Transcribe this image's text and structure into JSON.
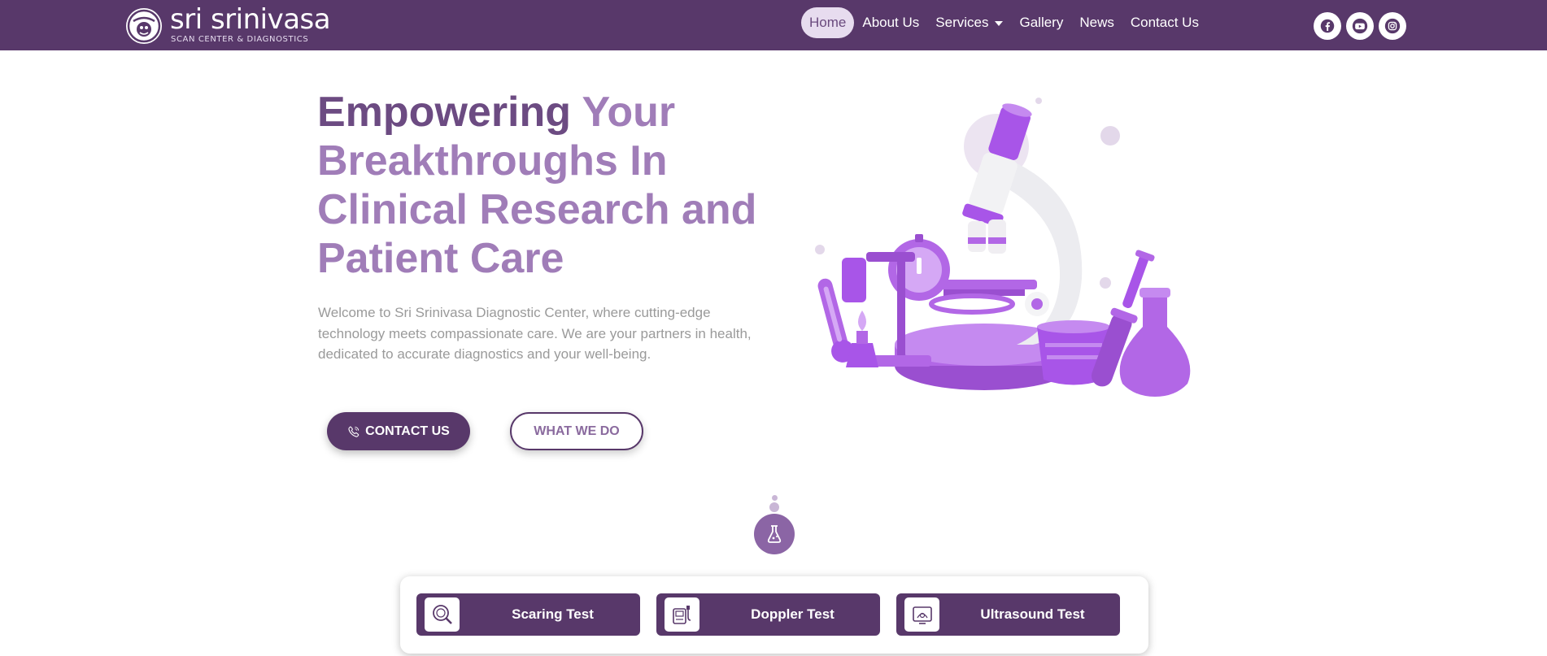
{
  "brand": {
    "name": "sri srinivasa",
    "tagline": "SCAN CENTER & DIAGNOSTICS"
  },
  "nav": {
    "items": [
      {
        "label": "Home",
        "active": true
      },
      {
        "label": "About Us"
      },
      {
        "label": "Services",
        "has_dropdown": true
      },
      {
        "label": "Gallery"
      },
      {
        "label": "News"
      },
      {
        "label": "Contact Us"
      }
    ]
  },
  "socials": [
    "facebook-icon",
    "youtube-icon",
    "instagram-icon"
  ],
  "hero": {
    "title_dark": "Empowering",
    "title_light": " Your Breakthroughs In Clinical Research and Patient Care",
    "text": "Welcome to Sri Srinivasa Diagnostic Center, where cutting-edge technology meets compassionate care. We are your partners in health, dedicated to accurate diagnostics and your well-being.",
    "contact_button": "CONTACT US",
    "what_button": "WHAT WE DO"
  },
  "services": [
    {
      "label": "Scaring Test",
      "icon": "magnifier-scan-icon"
    },
    {
      "label": "Doppler Test",
      "icon": "doppler-machine-icon"
    },
    {
      "label": "Ultrasound Test",
      "icon": "ultrasound-monitor-icon"
    }
  ],
  "colors": {
    "primary": "#58386a",
    "accent": "#a07db8",
    "title_dark": "#6c4b82",
    "body_text": "#9a9a9a"
  }
}
